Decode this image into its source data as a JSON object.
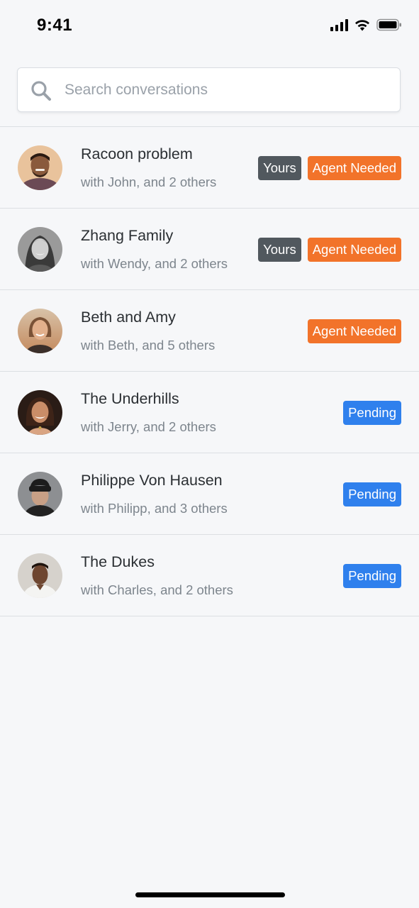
{
  "status_bar": {
    "time": "9:41"
  },
  "search": {
    "placeholder": "Search conversations",
    "value": ""
  },
  "colors": {
    "yours": "#51585e",
    "agent_needed": "#f2732a",
    "pending": "#2f80ed"
  },
  "conversations": [
    {
      "title": "Racoon problem",
      "subtitle": "with John, and 2 others",
      "badges": [
        {
          "label": "Yours",
          "kind": "yours"
        },
        {
          "label": "Agent Needed",
          "kind": "agent_needed"
        }
      ]
    },
    {
      "title": "Zhang Family",
      "subtitle": "with Wendy, and 2 others",
      "badges": [
        {
          "label": "Yours",
          "kind": "yours"
        },
        {
          "label": "Agent Needed",
          "kind": "agent_needed"
        }
      ]
    },
    {
      "title": "Beth and Amy",
      "subtitle": "with Beth, and 5 others",
      "badges": [
        {
          "label": "Agent Needed",
          "kind": "agent_needed"
        }
      ]
    },
    {
      "title": "The Underhills",
      "subtitle": "with Jerry, and 2 others",
      "badges": [
        {
          "label": "Pending",
          "kind": "pending"
        }
      ]
    },
    {
      "title": "Philippe Von Hausen",
      "subtitle": "with Philipp, and 3 others",
      "badges": [
        {
          "label": "Pending",
          "kind": "pending"
        }
      ]
    },
    {
      "title": "The Dukes",
      "subtitle": "with Charles, and 2 others",
      "badges": [
        {
          "label": "Pending",
          "kind": "pending"
        }
      ]
    }
  ]
}
